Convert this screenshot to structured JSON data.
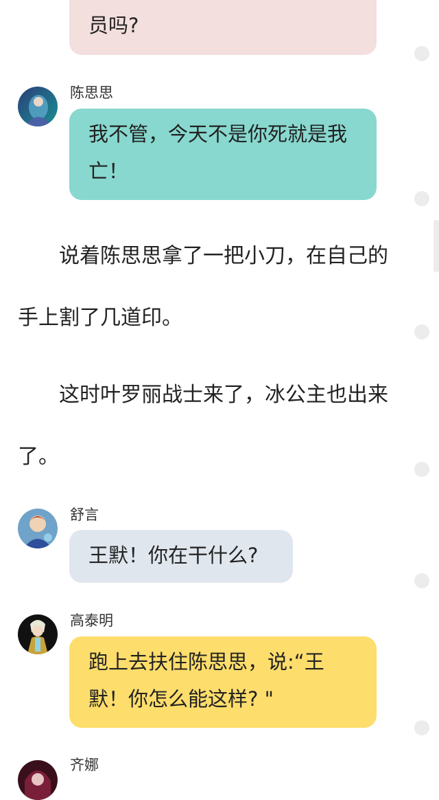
{
  "messages": [
    {
      "name": "",
      "text": "员吗?",
      "color": "#f3dfde"
    },
    {
      "name": "陈思思",
      "text": "我不管，今天不是你死就是我亡！",
      "color": "#88d8cf"
    },
    {
      "name": "舒言",
      "text": "王默！你在干什么?",
      "color": "#dfe6ee"
    },
    {
      "name": "高泰明",
      "text": "跑上去扶住陈思思，说:“王默！你怎么能这样? \"",
      "color": "#fddd6c"
    },
    {
      "name": "齐娜",
      "text": ""
    }
  ],
  "narration": [
    "说着陈思思拿了一把小刀，在自己的手上割了几道印。",
    "这时叶罗丽战士来了，冰公主也出来了。"
  ]
}
